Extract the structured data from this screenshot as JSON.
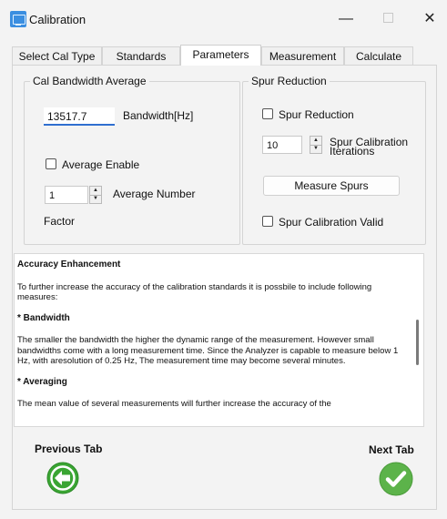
{
  "window": {
    "title": "Calibration",
    "minimize": "—",
    "close": "✕"
  },
  "tabs": [
    {
      "label": "Select Cal Type",
      "active": false
    },
    {
      "label": "Standards",
      "active": false
    },
    {
      "label": "Parameters",
      "active": true
    },
    {
      "label": "Measurement",
      "active": false
    },
    {
      "label": "Calculate",
      "active": false
    }
  ],
  "cal_bandwidth_average": {
    "group_title": "Cal Bandwidth  Average",
    "bandwidth_value": "13517.7",
    "bandwidth_label": "Bandwidth[Hz]",
    "average_enable_label": "Average Enable",
    "average_enable_checked": false,
    "average_number_value": "1",
    "average_number_label": "Average Number",
    "factor_label": "Factor"
  },
  "spur_reduction": {
    "group_title": "Spur Reduction",
    "spur_reduction_label": "Spur Reduction",
    "spur_reduction_checked": false,
    "iterations_value": "10",
    "iterations_label_line1": "Spur Calibration",
    "iterations_label_line2": "Iterations",
    "measure_spurs_label": "Measure Spurs",
    "spur_valid_label": "Spur Calibration Valid",
    "spur_valid_checked": false
  },
  "info": {
    "heading": "Accuracy Enhancement",
    "intro": "To further increase the accuracy of the calibration standards it is possbile to include following measures:",
    "bandwidth_heading": "* Bandwidth",
    "bandwidth_text": "The smaller the bandwidth the higher the dynamic range of the measurement. However small bandwidths come with a long measurement time. Since the Analyzer is capable to measure below 1 Hz, with aresolution of 0.25 Hz, The measurement time may become several minutes.",
    "averaging_heading": "* Averaging",
    "averaging_text": "The mean value of several measurements will further increase the accuracy of the"
  },
  "navigation": {
    "previous_label": "Previous Tab",
    "next_label": "Next Tab"
  },
  "colors": {
    "accent": "#2f6fd0",
    "prev_icon": "#3aa533",
    "next_icon": "#5cb34a"
  },
  "icons": {
    "app": "app-icon",
    "previous": "arrow-left-icon",
    "next": "checkmark-icon"
  }
}
